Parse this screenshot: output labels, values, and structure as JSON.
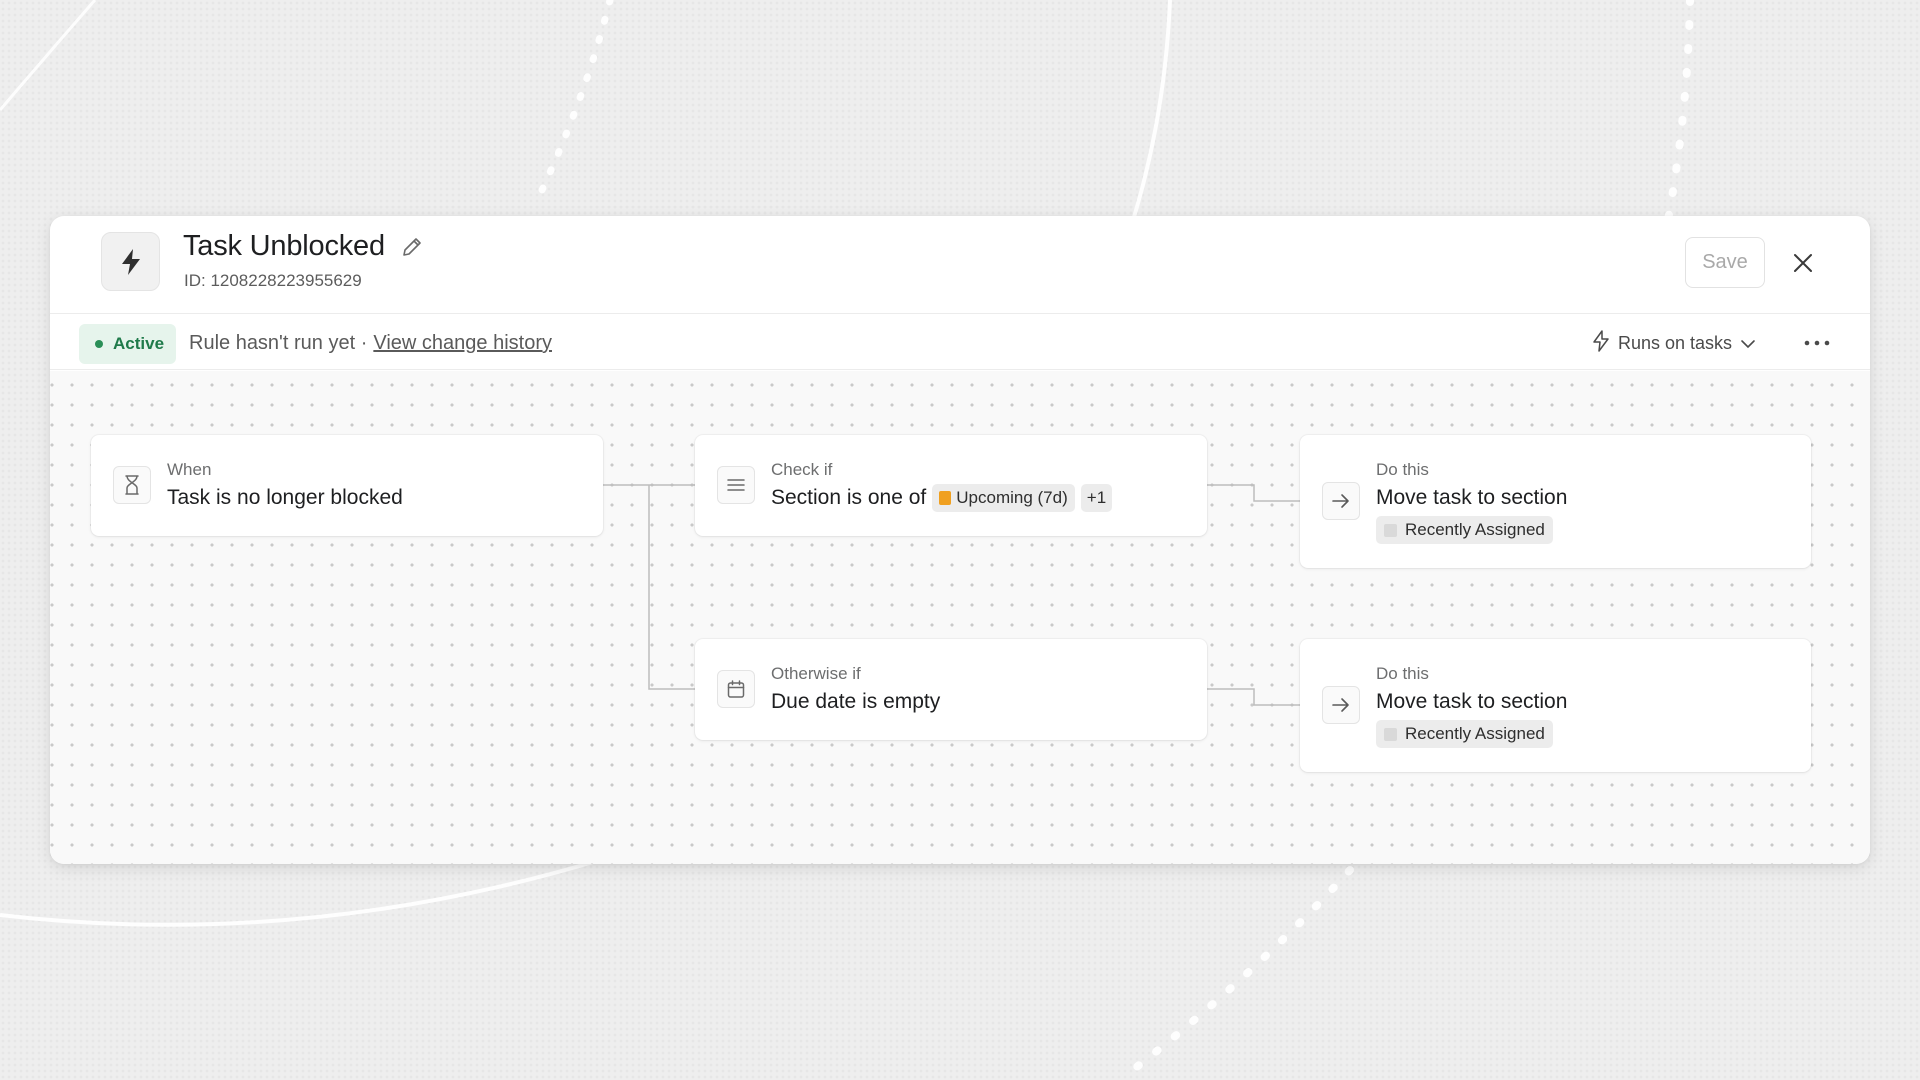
{
  "rule": {
    "title": "Task Unblocked",
    "id_text": "ID: 1208228223955629",
    "save_label": "Save"
  },
  "status": {
    "badge_label": "Active",
    "run_text": "Rule hasn't run yet ·",
    "history_link": "View change history",
    "runs_on_label": "Runs on tasks"
  },
  "trigger": {
    "kicker": "When",
    "text": "Task is no longer blocked"
  },
  "conditions": [
    {
      "kicker": "Check if",
      "text": "Section is one of",
      "chip_label": "Upcoming (7d)",
      "chip_color": "#f0a020",
      "extra_count": "+1"
    },
    {
      "kicker": "Otherwise if",
      "text": "Due date is empty"
    }
  ],
  "actions": [
    {
      "kicker": "Do this",
      "text": "Move task to section",
      "section_label": "Recently Assigned"
    },
    {
      "kicker": "Do this",
      "text": "Move task to section",
      "section_label": "Recently Assigned"
    }
  ],
  "colors": {
    "active_green": "#1f7a4a",
    "active_bg": "#e6f4ec"
  },
  "icons": {
    "rule": "lightning-bolt-icon",
    "edit": "pencil-icon",
    "close": "close-icon",
    "runs_on": "lightning-outline-icon",
    "more": "ellipsis-icon",
    "trigger": "hourglass-icon",
    "condition": "lines-icon",
    "otherwise": "calendar-icon",
    "action": "arrow-right-icon"
  }
}
